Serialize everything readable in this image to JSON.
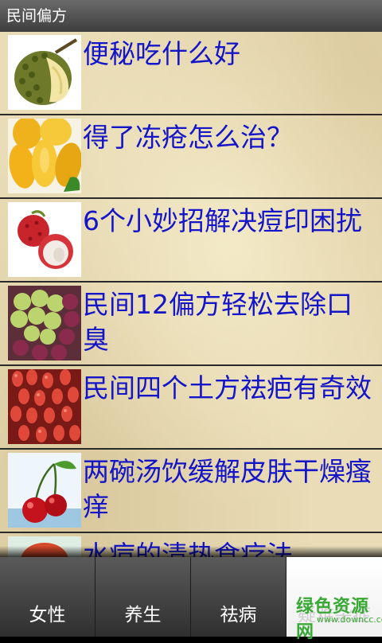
{
  "app": {
    "title": "民间偏方"
  },
  "list": [
    {
      "title": "便秘吃什么好",
      "image": "durian"
    },
    {
      "title": "得了冻疮怎么治？",
      "image": "mango"
    },
    {
      "title": "6个小妙招解决痘印困扰",
      "image": "lychee"
    },
    {
      "title": "民间12偏方轻松去除口臭",
      "image": "grapes"
    },
    {
      "title": "民间四个土方祛疤有奇效",
      "image": "red-berries"
    },
    {
      "title": "两碗汤饮缓解皮肤干燥瘙痒",
      "image": "cherries"
    },
    {
      "title": "水痘的清热食疗法",
      "image": "fruit"
    }
  ],
  "tabs": [
    {
      "label": "女性"
    },
    {
      "label": "养生"
    },
    {
      "label": "祛病"
    },
    {
      "label": "疑难杂症"
    }
  ],
  "watermark": {
    "text": "绿色资源网",
    "url": "www.downcc.com"
  },
  "colors": {
    "link": "#1414c8",
    "accent_watermark": "#39a935"
  }
}
